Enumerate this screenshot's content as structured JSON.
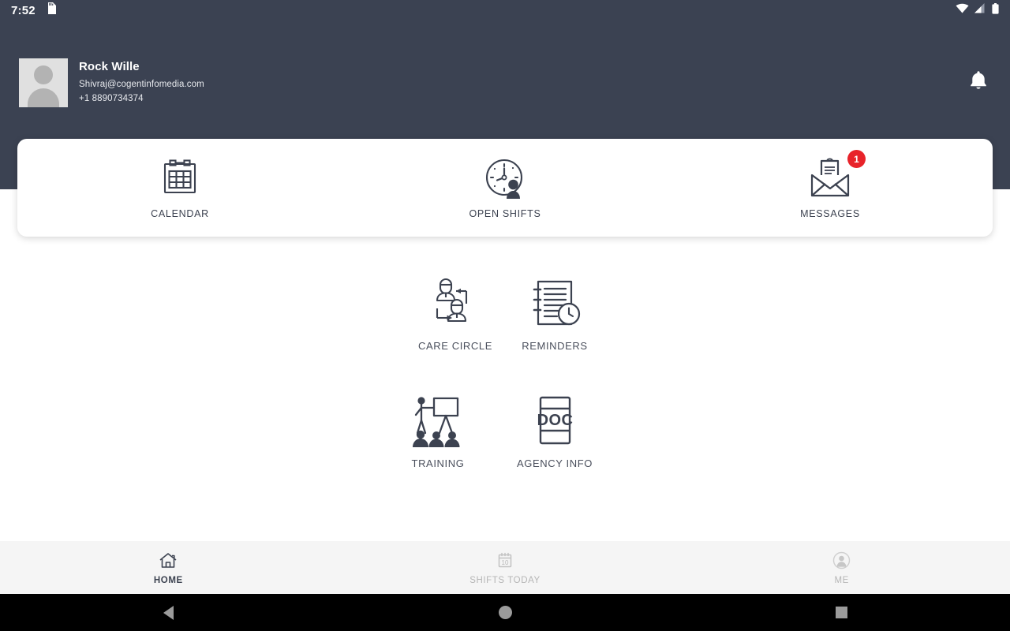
{
  "status_bar": {
    "time": "7:52",
    "icons": [
      "sd-card-icon",
      "wifi-icon",
      "cellular-signal-icon",
      "battery-icon"
    ]
  },
  "header": {
    "profile": {
      "name": "Rock Wille",
      "email": "Shivraj@cogentinfomedia.com",
      "phone": "+1 8890734374",
      "avatar_alt": "avatar-placeholder"
    },
    "notification_icon": "bell-icon",
    "background_color": "#3b4252"
  },
  "quick_card": {
    "items": [
      {
        "label": "CALENDAR",
        "icon": "calendar-icon",
        "badge": null
      },
      {
        "label": "OPEN SHIFTS",
        "icon": "clock-person-icon",
        "badge": null
      },
      {
        "label": "MESSAGES",
        "icon": "open-envelope-icon",
        "badge": "1"
      }
    ],
    "badge_color": "#e8232a"
  },
  "main_grid": {
    "rows": [
      [
        {
          "label": "CARE CIRCLE",
          "icon": "care-circle-icon"
        },
        {
          "label": "REMINDERS",
          "icon": "notepad-clock-icon"
        }
      ],
      [
        {
          "label": "TRAINING",
          "icon": "training-presenter-icon"
        },
        {
          "label": "AGENCY INFO",
          "icon": "doc-icon"
        }
      ]
    ]
  },
  "tab_bar": {
    "tabs": [
      {
        "label": "HOME",
        "icon": "home-icon",
        "active": true
      },
      {
        "label": "SHIFTS TODAY",
        "icon": "calendar-10-icon",
        "active": false
      },
      {
        "label": "ME",
        "icon": "person-circle-icon",
        "active": false
      }
    ],
    "active_color": "#3c4250",
    "inactive_color": "#b6b6b6"
  },
  "nav_bar": {
    "buttons": [
      {
        "name": "back-button",
        "icon": "triangle-back-icon"
      },
      {
        "name": "home-button",
        "icon": "circle-home-icon"
      },
      {
        "name": "recents-button",
        "icon": "square-recents-icon"
      }
    ]
  }
}
